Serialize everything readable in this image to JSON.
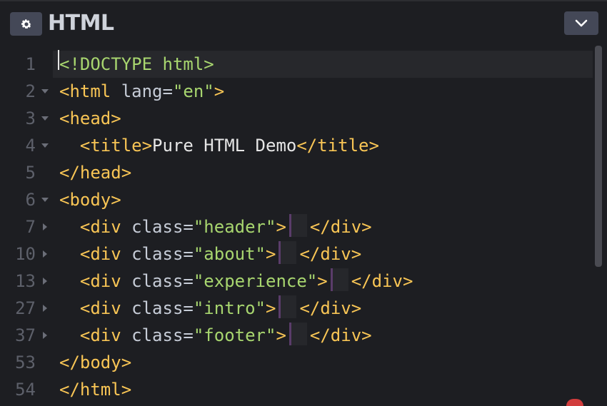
{
  "panel": {
    "title": "HTML",
    "settings_icon": "gear-icon",
    "collapse_icon": "chevron-down-icon"
  },
  "editor": {
    "lines": [
      {
        "num": "1",
        "foldable": false,
        "folded": false,
        "segments": [
          {
            "t": "<!DOCTYPE html>",
            "c": "doctype"
          }
        ]
      },
      {
        "num": "2",
        "foldable": true,
        "folded": false,
        "segments": [
          {
            "t": "<html",
            "c": "tag"
          },
          {
            "t": " lang=",
            "c": "attr"
          },
          {
            "t": "\"en\"",
            "c": "str"
          },
          {
            "t": ">",
            "c": "tag"
          }
        ]
      },
      {
        "num": "3",
        "foldable": true,
        "folded": false,
        "segments": [
          {
            "t": "<head>",
            "c": "tag"
          }
        ]
      },
      {
        "num": "4",
        "foldable": true,
        "folded": false,
        "segments": [
          {
            "t": "  <title>",
            "c": "tag"
          },
          {
            "t": "Pure HTML Demo",
            "c": "plain"
          },
          {
            "t": "</title>",
            "c": "tag"
          }
        ]
      },
      {
        "num": "5",
        "foldable": false,
        "folded": false,
        "segments": [
          {
            "t": "</head>",
            "c": "tag"
          }
        ]
      },
      {
        "num": "6",
        "foldable": true,
        "folded": false,
        "segments": [
          {
            "t": "<body>",
            "c": "tag"
          }
        ]
      },
      {
        "num": "7",
        "foldable": true,
        "folded": true,
        "segments": [
          {
            "t": "  <div",
            "c": "tag"
          },
          {
            "t": " class=",
            "c": "attr"
          },
          {
            "t": "\"header\"",
            "c": "str"
          },
          {
            "t": ">",
            "c": "tag"
          },
          {
            "t": "",
            "c": "fold"
          },
          {
            "t": "</div>",
            "c": "tag"
          }
        ]
      },
      {
        "num": "10",
        "foldable": true,
        "folded": true,
        "segments": [
          {
            "t": "  <div",
            "c": "tag"
          },
          {
            "t": " class=",
            "c": "attr"
          },
          {
            "t": "\"about\"",
            "c": "str"
          },
          {
            "t": ">",
            "c": "tag"
          },
          {
            "t": "",
            "c": "fold"
          },
          {
            "t": "</div>",
            "c": "tag"
          }
        ]
      },
      {
        "num": "13",
        "foldable": true,
        "folded": true,
        "segments": [
          {
            "t": "  <div",
            "c": "tag"
          },
          {
            "t": " class=",
            "c": "attr"
          },
          {
            "t": "\"experience\"",
            "c": "str"
          },
          {
            "t": ">",
            "c": "tag"
          },
          {
            "t": "",
            "c": "fold"
          },
          {
            "t": "</div>",
            "c": "tag"
          }
        ]
      },
      {
        "num": "27",
        "foldable": true,
        "folded": true,
        "segments": [
          {
            "t": "  <div",
            "c": "tag"
          },
          {
            "t": " class=",
            "c": "attr"
          },
          {
            "t": "\"intro\"",
            "c": "str"
          },
          {
            "t": ">",
            "c": "tag"
          },
          {
            "t": "",
            "c": "fold"
          },
          {
            "t": "</div>",
            "c": "tag"
          }
        ]
      },
      {
        "num": "37",
        "foldable": true,
        "folded": true,
        "segments": [
          {
            "t": "  <div",
            "c": "tag"
          },
          {
            "t": " class=",
            "c": "attr"
          },
          {
            "t": "\"footer\"",
            "c": "str"
          },
          {
            "t": ">",
            "c": "tag"
          },
          {
            "t": "",
            "c": "fold"
          },
          {
            "t": "</div>",
            "c": "tag"
          }
        ]
      },
      {
        "num": "53",
        "foldable": false,
        "folded": false,
        "segments": [
          {
            "t": "</body>",
            "c": "tag"
          }
        ]
      },
      {
        "num": "54",
        "foldable": false,
        "folded": false,
        "segments": [
          {
            "t": "</html>",
            "c": "tag"
          }
        ]
      }
    ]
  },
  "colors": {
    "background": "#1d1e22",
    "button_bg": "#444857",
    "tag": "#f8c555",
    "attribute": "#c6ccd7",
    "string": "#a8d66f",
    "line_number": "#5d606a"
  }
}
